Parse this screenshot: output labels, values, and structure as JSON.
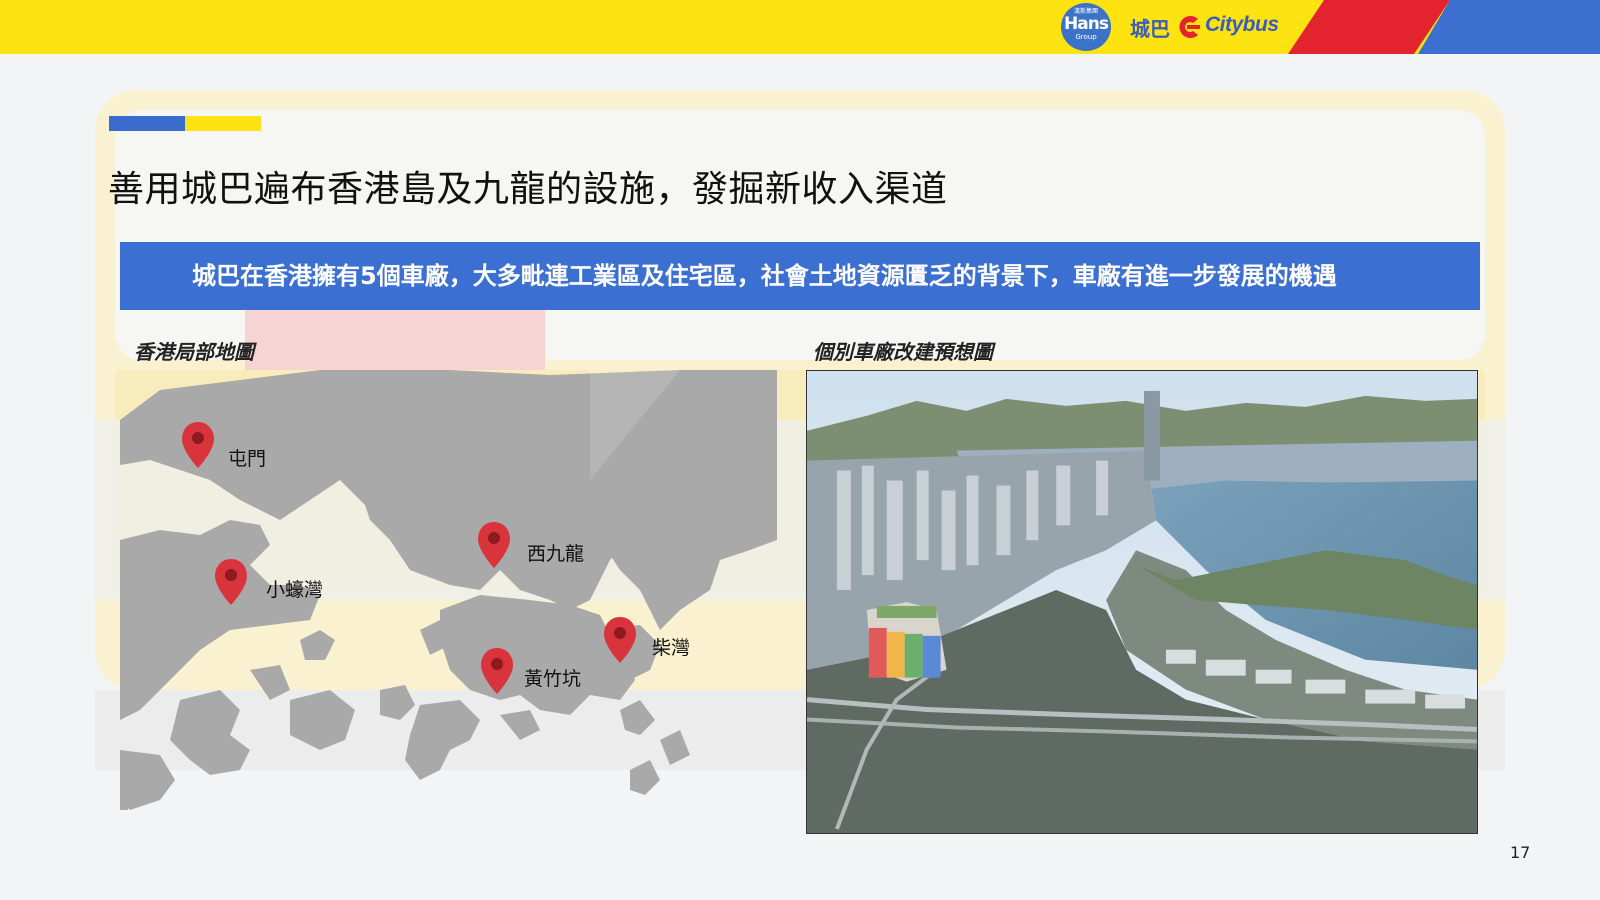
{
  "header": {
    "hans_logo": {
      "top": "漢斯集團",
      "main": "Hans",
      "bottom": "Group"
    },
    "citybus_zh": "城巴",
    "citybus_en": "Citybus",
    "colors": {
      "yellow": "#fde311",
      "red": "#e3232e",
      "blue": "#3d6fd0"
    }
  },
  "slide": {
    "title": "善用城巴遍布香港島及九龍的設施，發掘新收入渠道",
    "banner": "城巴在香港擁有5個車廠，大多毗連工業區及住宅區，社會土地資源匱乏的背景下，車廠有進一步發展的機遇",
    "map_caption": "香港局部地圖",
    "photo_caption": "個別車廠改建預想圖",
    "page_number": "17"
  },
  "map": {
    "depots": [
      {
        "name": "屯門",
        "icon": "map-pin-icon"
      },
      {
        "name": "西九龍",
        "icon": "map-pin-icon"
      },
      {
        "name": "小蠔灣",
        "icon": "map-pin-icon"
      },
      {
        "name": "柴灣",
        "icon": "map-pin-icon"
      },
      {
        "name": "黃竹坑",
        "icon": "map-pin-icon"
      }
    ]
  }
}
